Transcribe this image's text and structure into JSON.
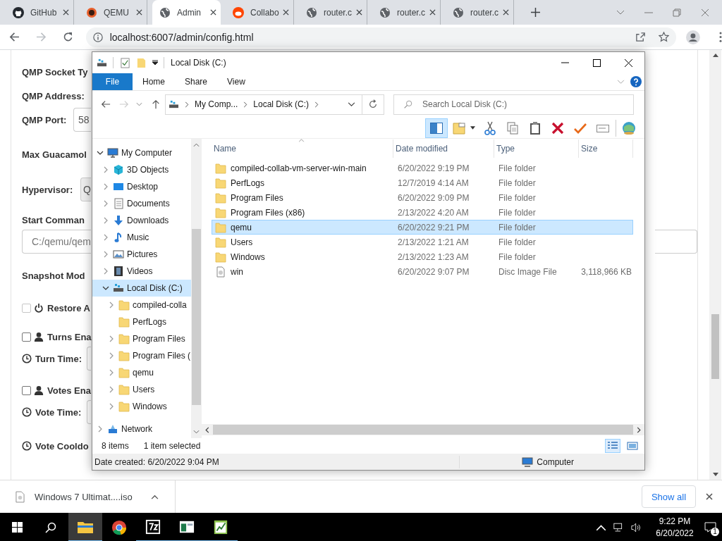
{
  "browser": {
    "tabs": [
      {
        "title": "GitHub",
        "kind": "github",
        "selected": false
      },
      {
        "title": "QEMU",
        "kind": "qemu",
        "selected": false
      },
      {
        "title": "Admin",
        "kind": "globe",
        "selected": true
      },
      {
        "title": "Collabo",
        "kind": "reddit",
        "selected": false
      },
      {
        "title": "router.c",
        "kind": "globe",
        "selected": false
      },
      {
        "title": "router.c",
        "kind": "globe",
        "selected": false
      },
      {
        "title": "router.c",
        "kind": "globe",
        "selected": false
      }
    ],
    "address": "localhost:6007/admin/config.html"
  },
  "page": {
    "rows": [
      {
        "kind": "label",
        "label": "QMP Socket Ty"
      },
      {
        "kind": "label",
        "label": "QMP Address:"
      },
      {
        "kind": "input",
        "label": "QMP Port:",
        "value": "58"
      },
      {
        "kind": "label",
        "label": "Max Guacamol"
      },
      {
        "kind": "select",
        "label": "Hypervisor:",
        "value": "Q"
      },
      {
        "kind": "label",
        "label": "Start Comman"
      },
      {
        "kind": "wide-input",
        "placeholder": "C:/qemu/qem"
      },
      {
        "kind": "label",
        "label": "Snapshot Mod"
      },
      {
        "kind": "power-check",
        "label": "Restore A",
        "checked": false,
        "disabled": true
      },
      {
        "kind": "user-check",
        "label": "Turns Ena",
        "checked": false,
        "disabled": false
      },
      {
        "kind": "clock-input",
        "label": "Turn Time:"
      },
      {
        "kind": "user-check",
        "label": "Votes Ena",
        "checked": false,
        "disabled": false
      },
      {
        "kind": "clock-input",
        "label": "Vote Time:"
      },
      {
        "kind": "clock-label",
        "label": "Vote Cooldo"
      }
    ]
  },
  "explorer": {
    "title": "Local Disk (C:)",
    "file_menu": "File",
    "ribbon_tabs": [
      "Home",
      "Share",
      "View"
    ],
    "breadcrumb": [
      "My Comp...",
      "Local Disk (C:)"
    ],
    "search": {
      "placeholder": "Search Local Disk (C:)"
    },
    "preview_pane_on": true,
    "tree": [
      {
        "label": "My Computer",
        "kind": "computer",
        "expanded": true,
        "selected": false,
        "children": [
          {
            "label": "3D Objects",
            "kind": "cube",
            "expanded": false,
            "selected": false
          },
          {
            "label": "Desktop",
            "kind": "desktop",
            "expanded": false,
            "selected": false
          },
          {
            "label": "Documents",
            "kind": "documents",
            "expanded": false,
            "selected": false
          },
          {
            "label": "Downloads",
            "kind": "downloads",
            "expanded": false,
            "selected": false
          },
          {
            "label": "Music",
            "kind": "music",
            "expanded": false,
            "selected": false
          },
          {
            "label": "Pictures",
            "kind": "pictures",
            "expanded": false,
            "selected": false
          },
          {
            "label": "Videos",
            "kind": "videos",
            "expanded": false,
            "selected": false
          },
          {
            "label": "Local Disk (C:)",
            "kind": "drive",
            "expanded": true,
            "selected": true,
            "children": [
              {
                "label": "compiled-colla",
                "kind": "folder",
                "expanded": false,
                "selected": false
              },
              {
                "label": "PerfLogs",
                "kind": "folder",
                "expanded": false,
                "expandable": false,
                "selected": false
              },
              {
                "label": "Program Files",
                "kind": "folder",
                "expanded": false,
                "selected": false
              },
              {
                "label": "Program Files (",
                "kind": "folder",
                "expanded": false,
                "selected": false
              },
              {
                "label": "qemu",
                "kind": "folder",
                "expanded": false,
                "selected": false
              },
              {
                "label": "Users",
                "kind": "folder",
                "expanded": false,
                "selected": false
              },
              {
                "label": "Windows",
                "kind": "folder",
                "expanded": false,
                "selected": false
              }
            ]
          }
        ]
      },
      {
        "label": "Network",
        "kind": "network",
        "expanded": false,
        "selected": false
      }
    ],
    "columns": [
      "Name",
      "Date modified",
      "Type",
      "Size"
    ],
    "files": [
      {
        "name": "compiled-collab-vm-server-win-main",
        "date": "6/20/2022 9:19 PM",
        "type": "File folder",
        "kind": "folder",
        "selected": false
      },
      {
        "name": "PerfLogs",
        "date": "12/7/2019 4:14 AM",
        "type": "File folder",
        "kind": "folder",
        "selected": false
      },
      {
        "name": "Program Files",
        "date": "6/20/2022 9:09 PM",
        "type": "File folder",
        "kind": "folder",
        "selected": false
      },
      {
        "name": "Program Files (x86)",
        "date": "2/13/2022 4:20 AM",
        "type": "File folder",
        "kind": "folder",
        "selected": false
      },
      {
        "name": "qemu",
        "date": "6/20/2022 9:21 PM",
        "type": "File folder",
        "kind": "folder",
        "selected": true
      },
      {
        "name": "Users",
        "date": "2/13/2022 1:21 AM",
        "type": "File folder",
        "kind": "folder",
        "selected": false
      },
      {
        "name": "Windows",
        "date": "2/13/2022 1:23 AM",
        "type": "File folder",
        "kind": "folder",
        "selected": false
      },
      {
        "name": "win",
        "date": "6/20/2022 9:07 PM",
        "type": "Disc Image File",
        "size": "3,118,966 KB",
        "kind": "disc",
        "selected": false
      }
    ],
    "item_count": "8 items",
    "selection_info": "1 item selected",
    "details": "Date created: 6/20/2022 9:04 PM",
    "location": "Computer"
  },
  "downloads": {
    "file": "Windows 7 Ultimat....iso",
    "show_all": "Show all"
  },
  "taskbar": {
    "apps": [
      {
        "kind": "explorer",
        "running": true,
        "active": true
      },
      {
        "kind": "chrome",
        "running": false,
        "active": false
      },
      {
        "kind": "sevenzip",
        "running": true,
        "active": false
      },
      {
        "kind": "window-app",
        "running": true,
        "active": false
      },
      {
        "kind": "notepad",
        "running": true,
        "active": false
      }
    ],
    "time": "9:22 PM",
    "date": "6/20/2022",
    "notifications": "1"
  }
}
